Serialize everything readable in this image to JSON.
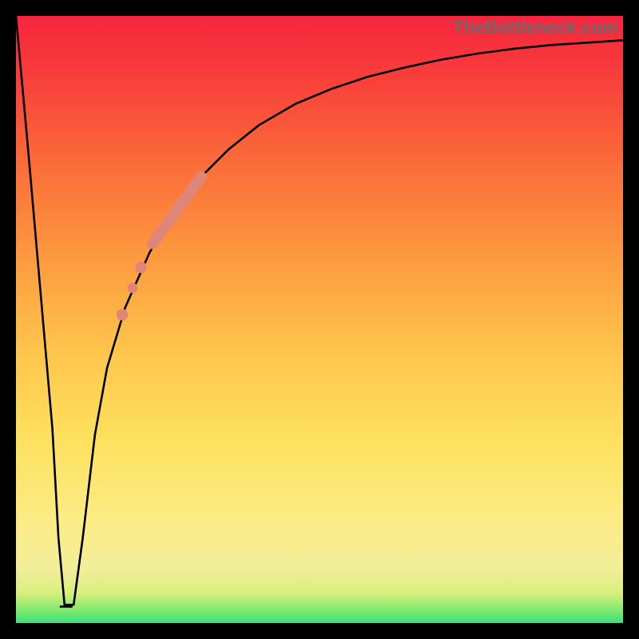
{
  "watermark": "TheBottleneck.com",
  "chart_data": {
    "type": "line",
    "title": "",
    "xlabel": "",
    "ylabel": "",
    "xlim": [
      0,
      100
    ],
    "ylim": [
      0,
      100
    ],
    "series": [
      {
        "name": "curve",
        "stroke": "#000000",
        "stroke_width": 2.6,
        "x": [
          0,
          2,
          4,
          6,
          7,
          8,
          9.5,
          11,
          13,
          15,
          18,
          22,
          26,
          30,
          35,
          40,
          46,
          52,
          58,
          64,
          70,
          76,
          82,
          88,
          94,
          100
        ],
        "y": [
          100,
          78,
          55,
          32,
          14,
          3,
          3,
          14,
          31,
          42,
          52,
          61,
          68,
          73,
          78,
          82,
          85.5,
          88,
          90,
          91.5,
          92.8,
          93.8,
          94.6,
          95.2,
          95.6,
          96
        ]
      },
      {
        "name": "flat-bottom",
        "stroke": "#000000",
        "stroke_width": 2.6,
        "x": [
          7.2,
          9.3
        ],
        "y": [
          2.7,
          2.7
        ]
      }
    ],
    "markers": [
      {
        "name": "highlight-segment",
        "stroke": "#e08678",
        "stroke_width": 14,
        "linecap": "round",
        "x": [
          22.5,
          30.5
        ],
        "y": [
          62.5,
          73.5
        ]
      },
      {
        "name": "dot-1",
        "type": "circle",
        "fill": "#e08678",
        "r": 7.2,
        "cx": 20.6,
        "cy": 58.6
      },
      {
        "name": "dot-2",
        "type": "circle",
        "fill": "#e08678",
        "r": 6.5,
        "cx": 19.2,
        "cy": 55.2
      },
      {
        "name": "dot-3",
        "type": "circle",
        "fill": "#e08678",
        "r": 7.2,
        "cx": 17.5,
        "cy": 50.8
      }
    ]
  }
}
